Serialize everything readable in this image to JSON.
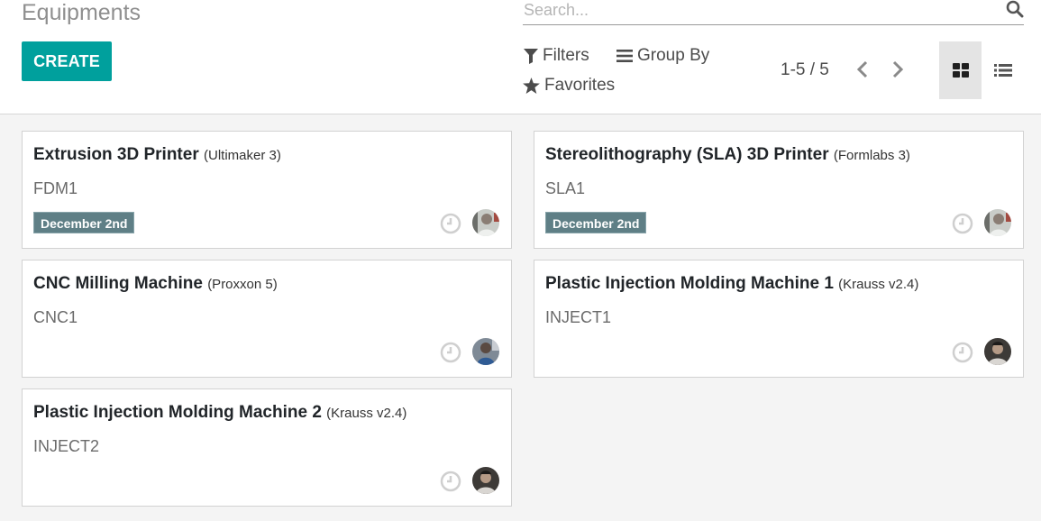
{
  "header": {
    "breadcrumb": "Equipments",
    "create_label": "CREATE"
  },
  "search": {
    "placeholder": "Search...",
    "value": ""
  },
  "search_options": {
    "filters_label": "Filters",
    "groupby_label": "Group By",
    "favorites_label": "Favorites"
  },
  "pager": {
    "value": "1-5 / 5"
  },
  "views": {
    "active": "kanban"
  },
  "colors": {
    "primary": "#00a09d",
    "date_badge": "#5f7f86"
  },
  "equipments": [
    {
      "name": "Extrusion 3D Printer",
      "model": "(Ultimaker 3)",
      "reference": "FDM1",
      "date": "December 2nd",
      "avatar": "avatar-light"
    },
    {
      "name": "Stereolithography (SLA) 3D Printer",
      "model": "(Formlabs 3)",
      "reference": "SLA1",
      "date": "December 2nd",
      "avatar": "avatar-light"
    },
    {
      "name": "CNC Milling Machine",
      "model": "(Proxxon 5)",
      "reference": "CNC1",
      "date": "",
      "avatar": "avatar-blue"
    },
    {
      "name": "Plastic Injection Molding Machine 1",
      "model": "(Krauss v2.4)",
      "reference": "INJECT1",
      "date": "",
      "avatar": "avatar-dark"
    },
    {
      "name": "Plastic Injection Molding Machine 2",
      "model": "(Krauss v2.4)",
      "reference": "INJECT2",
      "date": "",
      "avatar": "avatar-dark"
    }
  ]
}
